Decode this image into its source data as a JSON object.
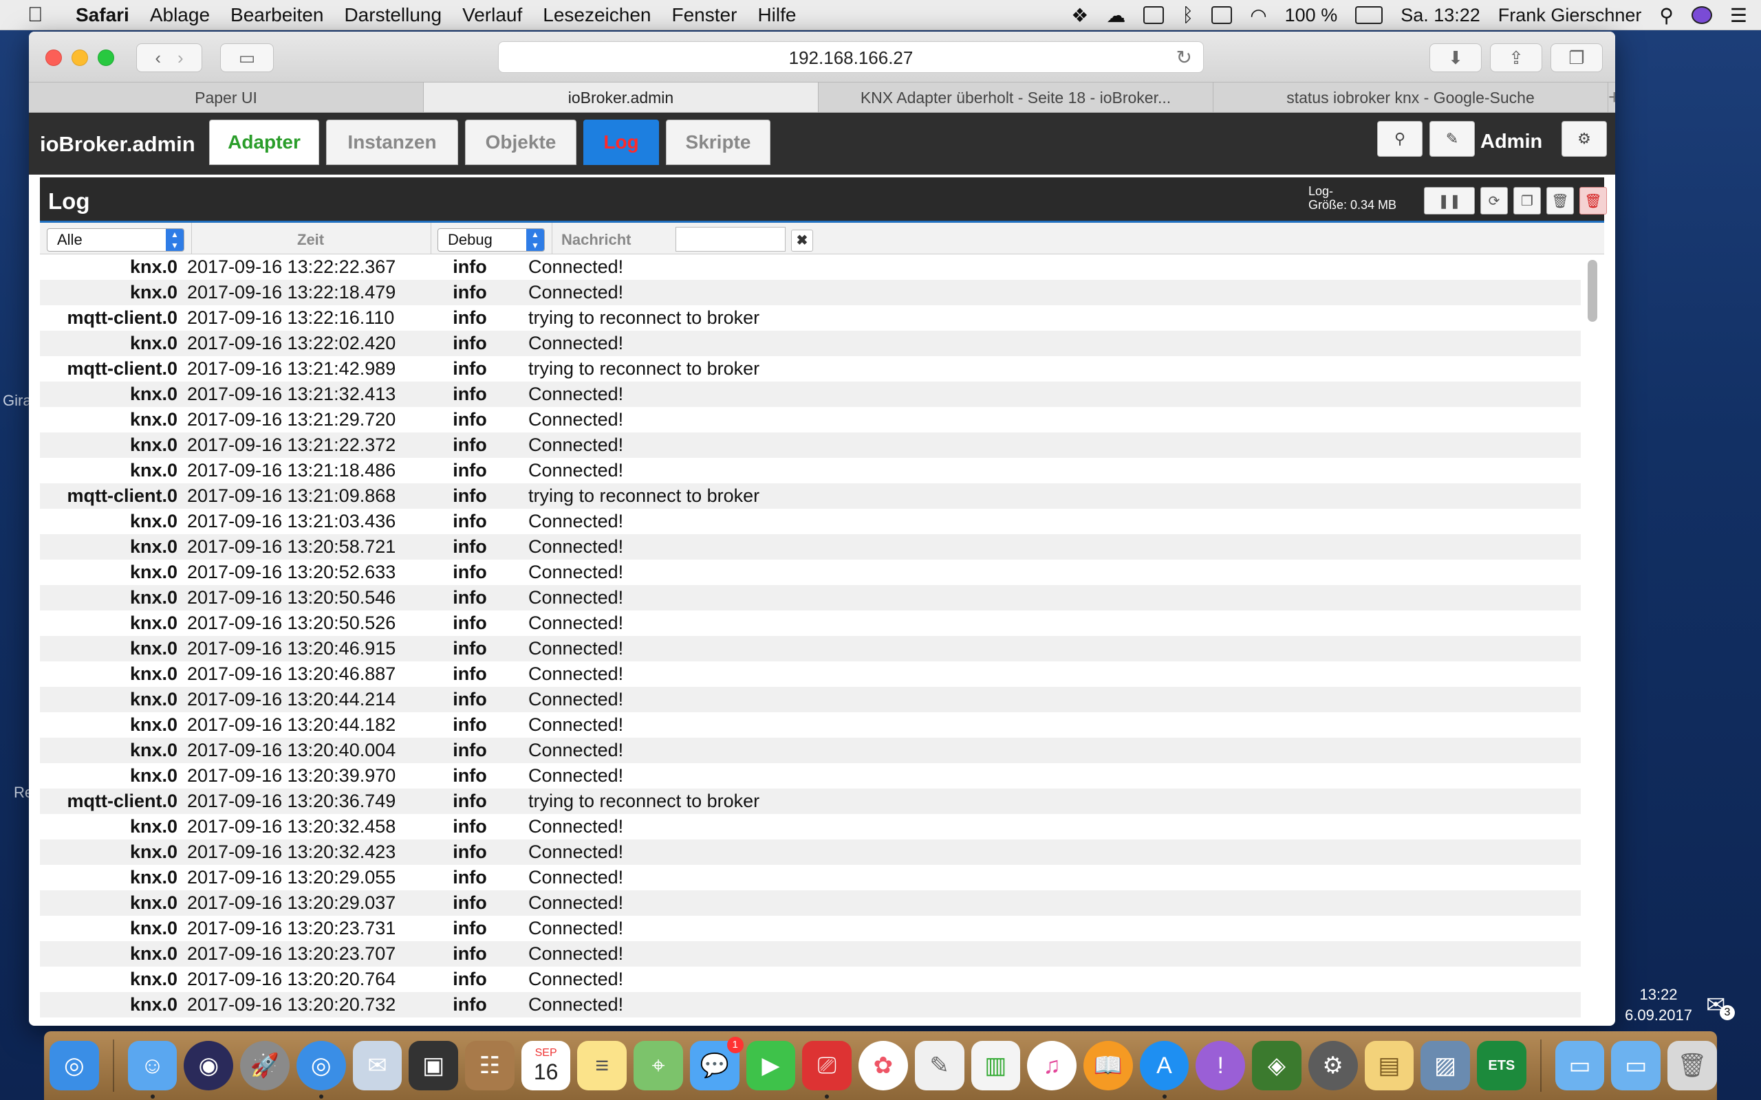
{
  "menubar": {
    "app": "Safari",
    "items": [
      "Ablage",
      "Bearbeiten",
      "Darstellung",
      "Verlauf",
      "Lesezeichen",
      "Fenster",
      "Hilfe"
    ],
    "battery": "100 %",
    "clock": "Sa. 13:22",
    "user": "Frank Gierschner"
  },
  "desktop": {
    "frag1": "Gira",
    "frag2": "Re"
  },
  "browser": {
    "url": "192.168.166.27",
    "tabs": [
      "Paper UI",
      "ioBroker.admin",
      "KNX Adapter überholt - Seite 18 - ioBroker...",
      "status iobroker knx - Google-Suche"
    ]
  },
  "iobroker": {
    "title": "ioBroker.admin",
    "nav": [
      "Adapter",
      "Instanzen",
      "Objekte",
      "Log",
      "Skripte"
    ],
    "user": "Admin"
  },
  "log": {
    "title": "Log",
    "size_label": "Log-",
    "size_value": "Größe: 0.34 MB",
    "filter_source": "Alle",
    "col_time": "Zeit",
    "filter_level": "Debug",
    "col_message": "Nachricht",
    "rows": [
      {
        "src": "knx.0",
        "time": "2017-09-16 13:22:22.367",
        "sev": "info",
        "msg": "Connected!"
      },
      {
        "src": "knx.0",
        "time": "2017-09-16 13:22:18.479",
        "sev": "info",
        "msg": "Connected!"
      },
      {
        "src": "mqtt-client.0",
        "time": "2017-09-16 13:22:16.110",
        "sev": "info",
        "msg": "trying to reconnect to broker"
      },
      {
        "src": "knx.0",
        "time": "2017-09-16 13:22:02.420",
        "sev": "info",
        "msg": "Connected!"
      },
      {
        "src": "mqtt-client.0",
        "time": "2017-09-16 13:21:42.989",
        "sev": "info",
        "msg": "trying to reconnect to broker"
      },
      {
        "src": "knx.0",
        "time": "2017-09-16 13:21:32.413",
        "sev": "info",
        "msg": "Connected!"
      },
      {
        "src": "knx.0",
        "time": "2017-09-16 13:21:29.720",
        "sev": "info",
        "msg": "Connected!"
      },
      {
        "src": "knx.0",
        "time": "2017-09-16 13:21:22.372",
        "sev": "info",
        "msg": "Connected!"
      },
      {
        "src": "knx.0",
        "time": "2017-09-16 13:21:18.486",
        "sev": "info",
        "msg": "Connected!"
      },
      {
        "src": "mqtt-client.0",
        "time": "2017-09-16 13:21:09.868",
        "sev": "info",
        "msg": "trying to reconnect to broker"
      },
      {
        "src": "knx.0",
        "time": "2017-09-16 13:21:03.436",
        "sev": "info",
        "msg": "Connected!"
      },
      {
        "src": "knx.0",
        "time": "2017-09-16 13:20:58.721",
        "sev": "info",
        "msg": "Connected!"
      },
      {
        "src": "knx.0",
        "time": "2017-09-16 13:20:52.633",
        "sev": "info",
        "msg": "Connected!"
      },
      {
        "src": "knx.0",
        "time": "2017-09-16 13:20:50.546",
        "sev": "info",
        "msg": "Connected!"
      },
      {
        "src": "knx.0",
        "time": "2017-09-16 13:20:50.526",
        "sev": "info",
        "msg": "Connected!"
      },
      {
        "src": "knx.0",
        "time": "2017-09-16 13:20:46.915",
        "sev": "info",
        "msg": "Connected!"
      },
      {
        "src": "knx.0",
        "time": "2017-09-16 13:20:46.887",
        "sev": "info",
        "msg": "Connected!"
      },
      {
        "src": "knx.0",
        "time": "2017-09-16 13:20:44.214",
        "sev": "info",
        "msg": "Connected!"
      },
      {
        "src": "knx.0",
        "time": "2017-09-16 13:20:44.182",
        "sev": "info",
        "msg": "Connected!"
      },
      {
        "src": "knx.0",
        "time": "2017-09-16 13:20:40.004",
        "sev": "info",
        "msg": "Connected!"
      },
      {
        "src": "knx.0",
        "time": "2017-09-16 13:20:39.970",
        "sev": "info",
        "msg": "Connected!"
      },
      {
        "src": "mqtt-client.0",
        "time": "2017-09-16 13:20:36.749",
        "sev": "info",
        "msg": "trying to reconnect to broker"
      },
      {
        "src": "knx.0",
        "time": "2017-09-16 13:20:32.458",
        "sev": "info",
        "msg": "Connected!"
      },
      {
        "src": "knx.0",
        "time": "2017-09-16 13:20:32.423",
        "sev": "info",
        "msg": "Connected!"
      },
      {
        "src": "knx.0",
        "time": "2017-09-16 13:20:29.055",
        "sev": "info",
        "msg": "Connected!"
      },
      {
        "src": "knx.0",
        "time": "2017-09-16 13:20:29.037",
        "sev": "info",
        "msg": "Connected!"
      },
      {
        "src": "knx.0",
        "time": "2017-09-16 13:20:23.731",
        "sev": "info",
        "msg": "Connected!"
      },
      {
        "src": "knx.0",
        "time": "2017-09-16 13:20:23.707",
        "sev": "info",
        "msg": "Connected!"
      },
      {
        "src": "knx.0",
        "time": "2017-09-16 13:20:20.764",
        "sev": "info",
        "msg": "Connected!"
      },
      {
        "src": "knx.0",
        "time": "2017-09-16 13:20:20.732",
        "sev": "info",
        "msg": "Connected!"
      }
    ]
  },
  "taskbar": {
    "time": "13:22",
    "date": "6.09.2017",
    "notif_count": "3"
  },
  "dock": {
    "calendar_month": "SEP",
    "calendar_day": "16",
    "messages_badge": "1",
    "ets_label": "ETS"
  }
}
